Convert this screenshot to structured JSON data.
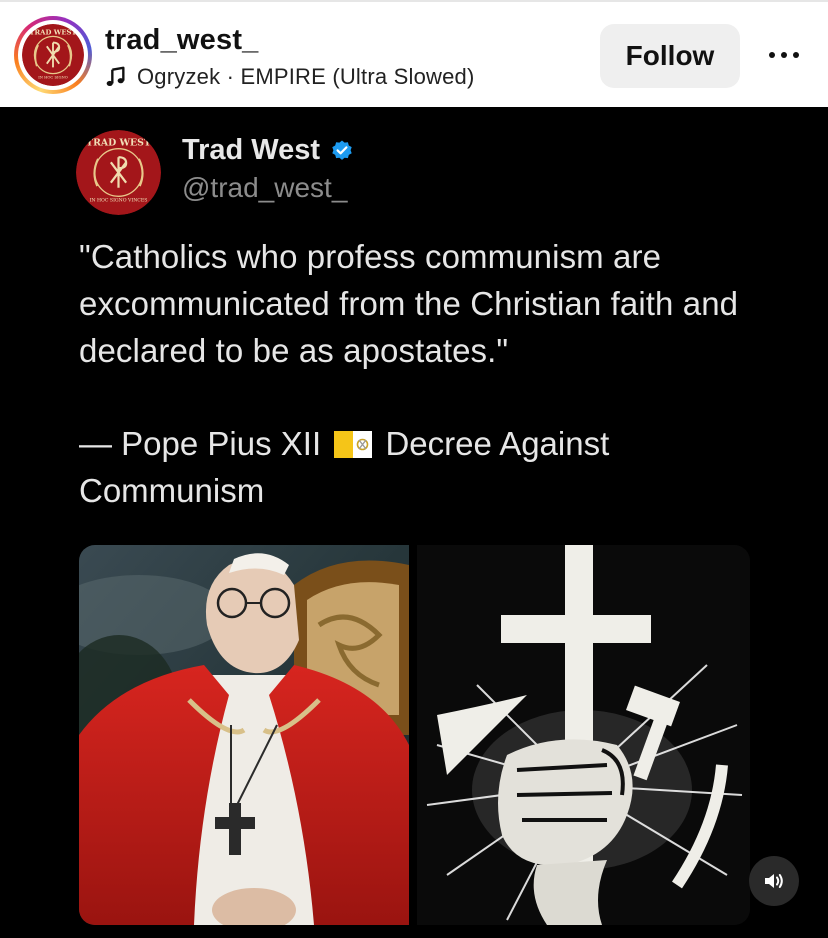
{
  "post": {
    "username": "trad_west_",
    "audio": "Ogryzek · EMPIRE (Ultra Slowed)",
    "follow_label": "Follow"
  },
  "tweet": {
    "display_name": "Trad West",
    "handle": "@trad_west_",
    "quote": "\"Catholics who profess communism are excommunicated from the Christian faith and declared to be as apostates.\"",
    "attribution_prefix": "— Pope Pius XII",
    "attribution_suffix": "Decree Against Communism"
  },
  "logo": {
    "top_text": "TRAD WEST",
    "bottom_text": "IN HOC SIGNO VINCES"
  },
  "icons": {
    "music": "music-note-icon",
    "verified": "verified-badge-icon",
    "more": "more-options-icon",
    "sound": "sound-on-icon",
    "flag": "vatican-flag-icon"
  },
  "colors": {
    "logo_red": "#a3161a",
    "verified_blue": "#1d9bf0",
    "follow_bg": "#efefef",
    "media_bg": "#000000"
  }
}
